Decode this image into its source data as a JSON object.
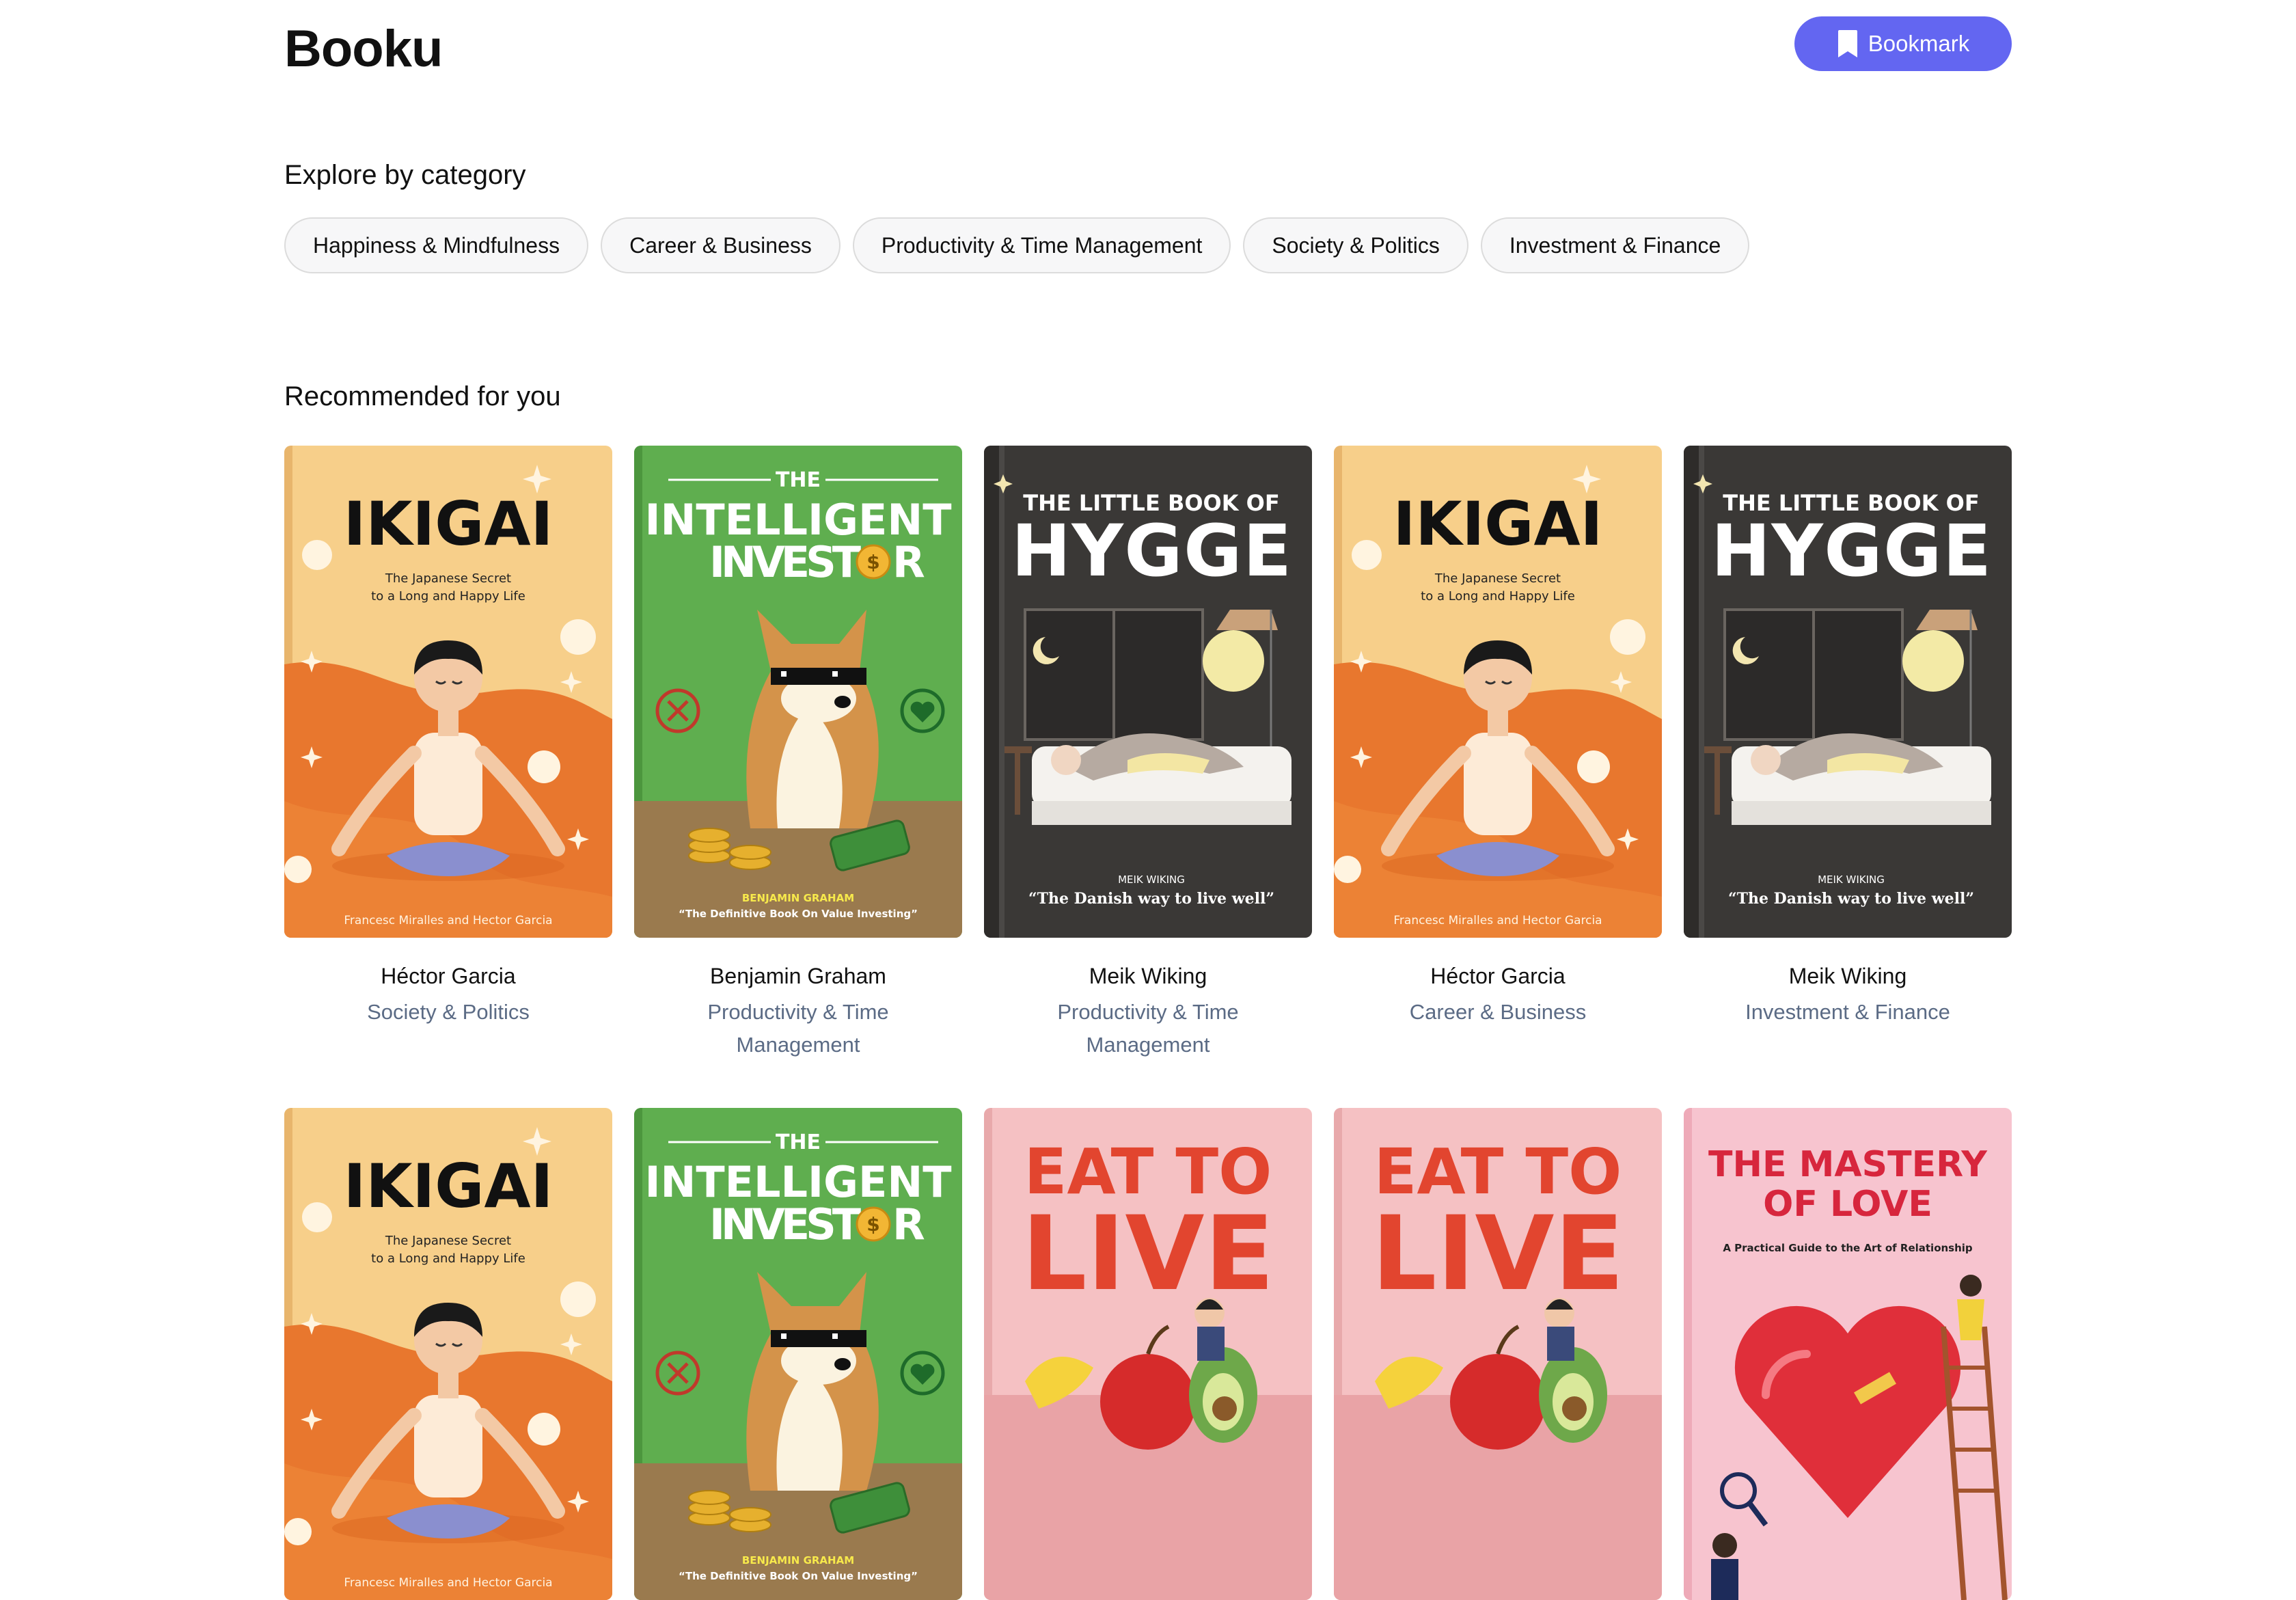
{
  "app": {
    "name": "Booku",
    "bookmark_label": "Bookmark"
  },
  "explore": {
    "title": "Explore by category",
    "categories": [
      "Happiness & Mindfulness",
      "Career & Business",
      "Productivity & Time Management",
      "Society & Politics",
      "Investment & Finance"
    ]
  },
  "recommended": {
    "title": "Recommended for you",
    "books": [
      {
        "cover": "ikigai",
        "author": "Héctor Garcia",
        "category": "Society & Politics"
      },
      {
        "cover": "investor",
        "author": "Benjamin Graham",
        "category": "Productivity & Time Management"
      },
      {
        "cover": "hygge",
        "author": "Meik Wiking",
        "category": "Productivity & Time Management"
      },
      {
        "cover": "ikigai",
        "author": "Héctor Garcia",
        "category": "Career & Business"
      },
      {
        "cover": "hygge",
        "author": "Meik Wiking",
        "category": "Investment & Finance"
      },
      {
        "cover": "ikigai",
        "author": "",
        "category": ""
      },
      {
        "cover": "investor",
        "author": "",
        "category": ""
      },
      {
        "cover": "eat",
        "author": "",
        "category": ""
      },
      {
        "cover": "eat",
        "author": "",
        "category": ""
      },
      {
        "cover": "love",
        "author": "",
        "category": ""
      }
    ]
  },
  "covers": {
    "ikigai": {
      "title": "IKIGAI",
      "subtitle_1": "The Japanese Secret",
      "subtitle_2": "to a Long and Happy Life",
      "byline": "Francesc Miralles and Hector Garcia"
    },
    "investor": {
      "the": "THE",
      "title_1": "INTELLIGENT",
      "title_2": "INVEST",
      "title_3": "R",
      "coin": "$",
      "author": "BENJAMIN GRAHAM",
      "tagline": "“The Definitive Book On Value Investing”"
    },
    "hygge": {
      "title_top": "THE  LITTLE BOOK OF",
      "title": "HYGGE",
      "author": "MEIK WIKING",
      "tagline": "“The Danish way to live well”"
    },
    "eat": {
      "title_1": "EAT TO",
      "title_2": "LIVE"
    },
    "love": {
      "title_1": "THE MASTERY",
      "title_2": "OF LOVE",
      "subtitle": "A Practical Guide to the Art of Relationship"
    }
  },
  "colors": {
    "accent": "#6366f1",
    "muted_text": "#5b6b85",
    "chip_border": "#dcdcdc"
  }
}
